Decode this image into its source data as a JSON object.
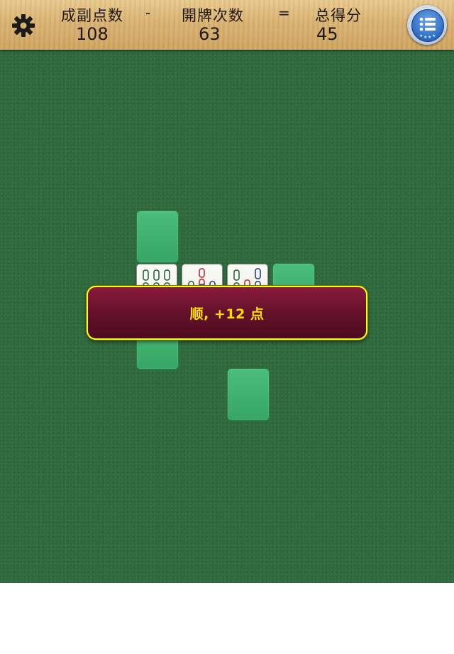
{
  "scoreboard": {
    "meld_points_label": "成副点数",
    "operator_minus": "-",
    "draws_label": "開牌次数",
    "operator_equals": "=",
    "total_label": "总得分",
    "meld_points_value": "108",
    "draws_value": "63",
    "total_value": "45"
  },
  "icons": {
    "settings": "gear-icon",
    "menu": "list-icon"
  },
  "board": {
    "tiles": [
      {
        "suit": "bamboo",
        "rank": 9
      },
      {
        "suit": "bamboo",
        "rank": 5
      },
      {
        "suit": "bamboo",
        "rank": 7
      }
    ]
  },
  "message": {
    "text": "顺, +12 点"
  },
  "colors": {
    "felt": "#2f6a3d",
    "slot": "#3fb06e",
    "banner": "#641129",
    "banner_border": "#f6ff1a",
    "banner_text": "#ffe000"
  }
}
